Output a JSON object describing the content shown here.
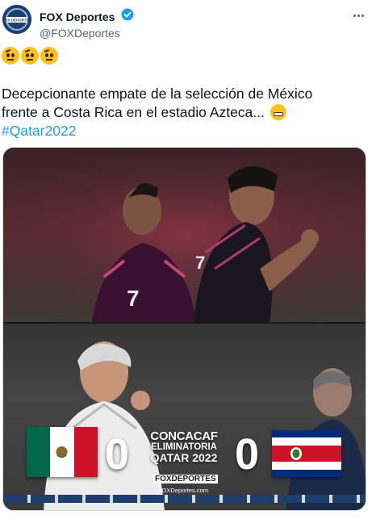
{
  "author": {
    "display_name": "FOX Deportes",
    "handle": "@FOXDeportes",
    "avatar_text": "FOX DEPORTES"
  },
  "tweet": {
    "emojis": [
      "thinking-raised-eyebrow",
      "thinking-raised-eyebrow",
      "thinking-raised-eyebrow"
    ],
    "line1": "Decepcionante empate de la selección de México",
    "line2": "frente a Costa Rica en el estadio Azteca...",
    "hashtag": "#Qatar2022"
  },
  "media": {
    "home_score": "0",
    "away_score": "0",
    "competition_line1": "CONCACAF",
    "competition_line2": "ELIMINATORIA",
    "competition_line3": "QATAR 2022",
    "brand_logo": "FOXDEPORTES",
    "brand_url": "FOXDeportes.com"
  },
  "colors": {
    "accent": "#1d9bf0",
    "text": "#0f1419",
    "muted": "#536471",
    "mexico_green": "#006847",
    "mexico_red": "#ce1126",
    "costa_rica_blue": "#002b7f",
    "costa_rica_red": "#ce1126"
  }
}
